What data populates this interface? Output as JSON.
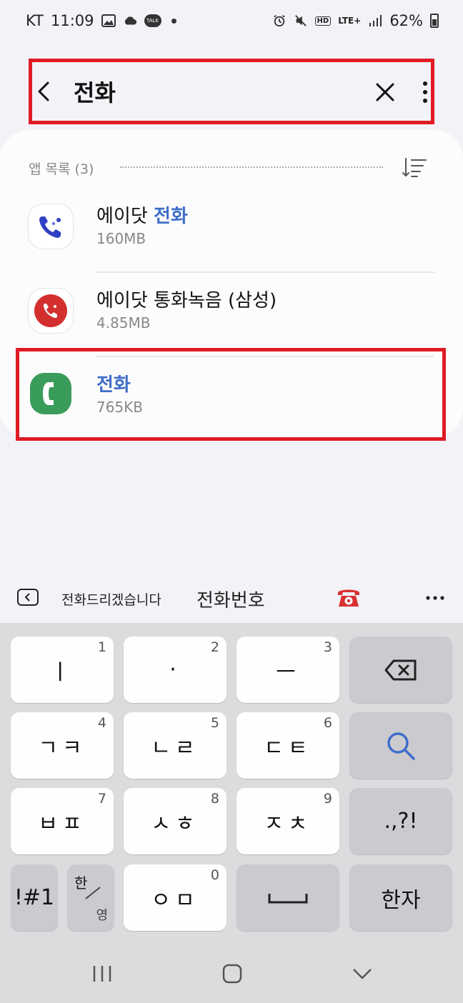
{
  "status_bar": {
    "carrier": "KT",
    "time": "11:09",
    "talk_badge": "TALK",
    "hd_badge": "HD",
    "network": "LTE+",
    "battery": "62%"
  },
  "header": {
    "search_query": "전화"
  },
  "results": {
    "section_label": "앱 목록 (3)",
    "apps": [
      {
        "name_prefix": "에이닷 ",
        "name_highlight": "전화",
        "name_suffix": "",
        "size": "160MB",
        "icon": "adot-phone-icon"
      },
      {
        "name_prefix": "에이닷 통화녹음 (삼성)",
        "name_highlight": "",
        "name_suffix": "",
        "size": "4.85MB",
        "icon": "adot-call-record-icon"
      },
      {
        "name_prefix": "",
        "name_highlight": "전화",
        "name_suffix": "",
        "size": "765KB",
        "icon": "samsung-phone-icon"
      }
    ]
  },
  "suggestions": {
    "items": [
      "전화드리겠습니다",
      "전화번호"
    ],
    "emoji": "telephone-emoji"
  },
  "keyboard": {
    "row1": [
      {
        "label": "ㅣ",
        "num": "1"
      },
      {
        "label": "·",
        "num": "2"
      },
      {
        "label": "ㅡ",
        "num": "3"
      }
    ],
    "row2": [
      {
        "label": "ㄱㅋ",
        "num": "4"
      },
      {
        "label": "ㄴㄹ",
        "num": "5"
      },
      {
        "label": "ㄷㅌ",
        "num": "6"
      }
    ],
    "row3": [
      {
        "label": "ㅂㅍ",
        "num": "7"
      },
      {
        "label": "ㅅㅎ",
        "num": "8"
      },
      {
        "label": "ㅈㅊ",
        "num": "9"
      }
    ],
    "punct": ".,?!",
    "symbols": "!#1",
    "lang_top": "한",
    "lang_bottom": "영",
    "row4_center": {
      "label": "ㅇㅁ",
      "num": "0"
    },
    "hanja": "한자"
  },
  "colors": {
    "highlight_border": "#e01b24",
    "accent_blue": "#3e6dc9",
    "phone_green": "#3a9c5a"
  }
}
